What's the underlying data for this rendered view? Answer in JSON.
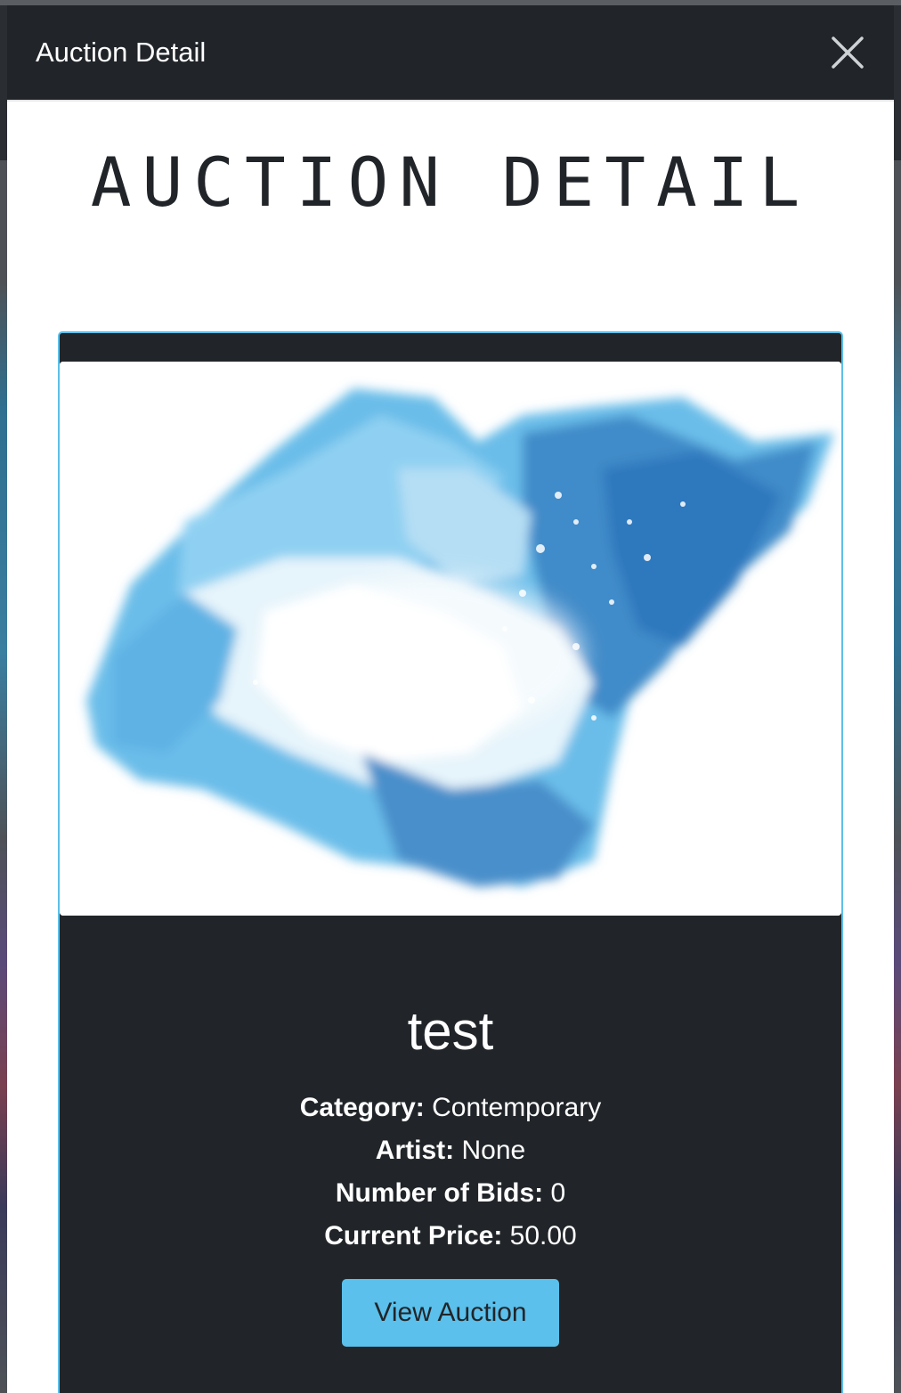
{
  "modal": {
    "title": "Auction Detail",
    "close_icon": "close-icon"
  },
  "page": {
    "heading": "AUCTION DETAIL"
  },
  "auction": {
    "title": "test",
    "category_label": "Category:",
    "category_value": "Contemporary",
    "artist_label": "Artist:",
    "artist_value": "None",
    "bids_label": "Number of Bids:",
    "bids_value": "0",
    "price_label": "Current Price:",
    "price_value": "50.00",
    "button_label": "View Auction"
  },
  "colors": {
    "header_bg": "#212529",
    "card_bg": "#212529",
    "accent": "#5bc0eb",
    "text_light": "#ffffff"
  }
}
